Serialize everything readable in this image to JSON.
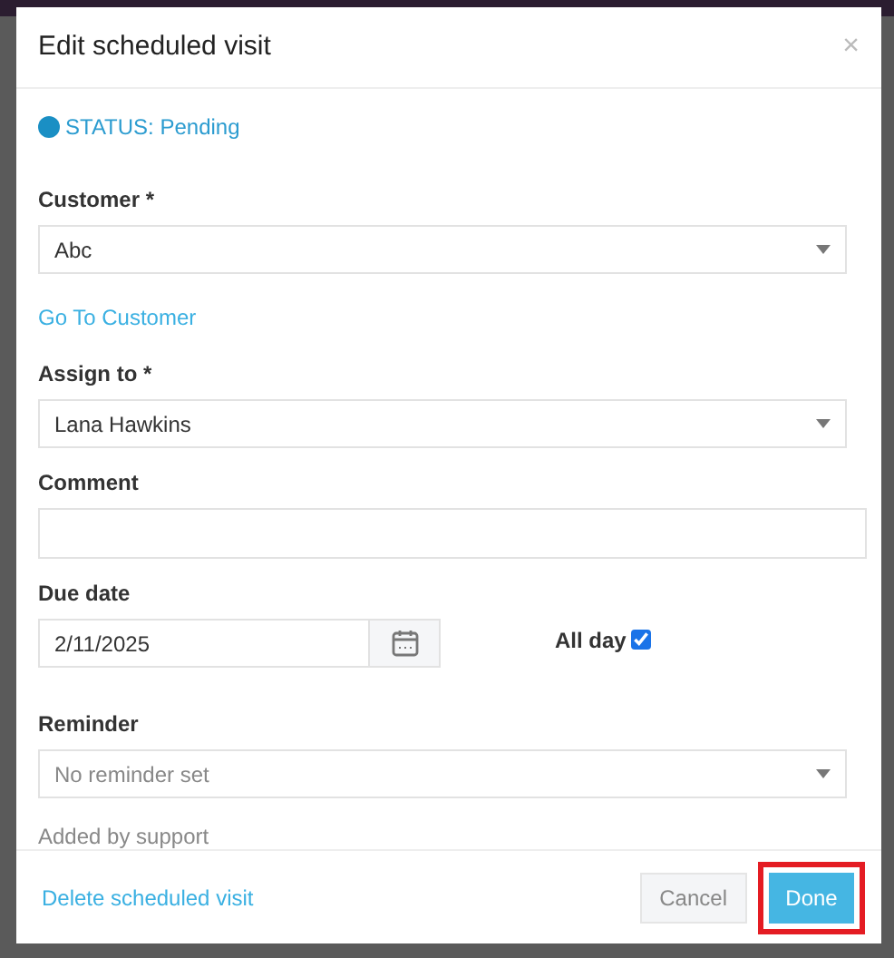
{
  "dialog": {
    "title": "Edit scheduled visit",
    "close": "×"
  },
  "status": {
    "label": "STATUS: Pending",
    "color": "#1a8fc4"
  },
  "fields": [
    {
      "kind": "select",
      "label": "Customer *",
      "value": "Abc"
    },
    {
      "kind": "link",
      "label": "Go To Customer"
    },
    {
      "kind": "select",
      "label": "Assign to *",
      "value": "Lana Hawkins"
    },
    {
      "kind": "text",
      "label": "Comment"
    },
    {
      "kind": "date",
      "label": "Due date",
      "value": "2/11/2025",
      "checkbox": {
        "label": "All day",
        "checked": true
      }
    },
    {
      "kind": "select",
      "label": "Reminder",
      "placeholder": "No reminder set"
    },
    {
      "kind": "note",
      "label": "Added by support"
    }
  ],
  "footer": {
    "delete": "Delete scheduled visit",
    "cancel": "Cancel",
    "done": "Done",
    "done_highlighted": true
  }
}
